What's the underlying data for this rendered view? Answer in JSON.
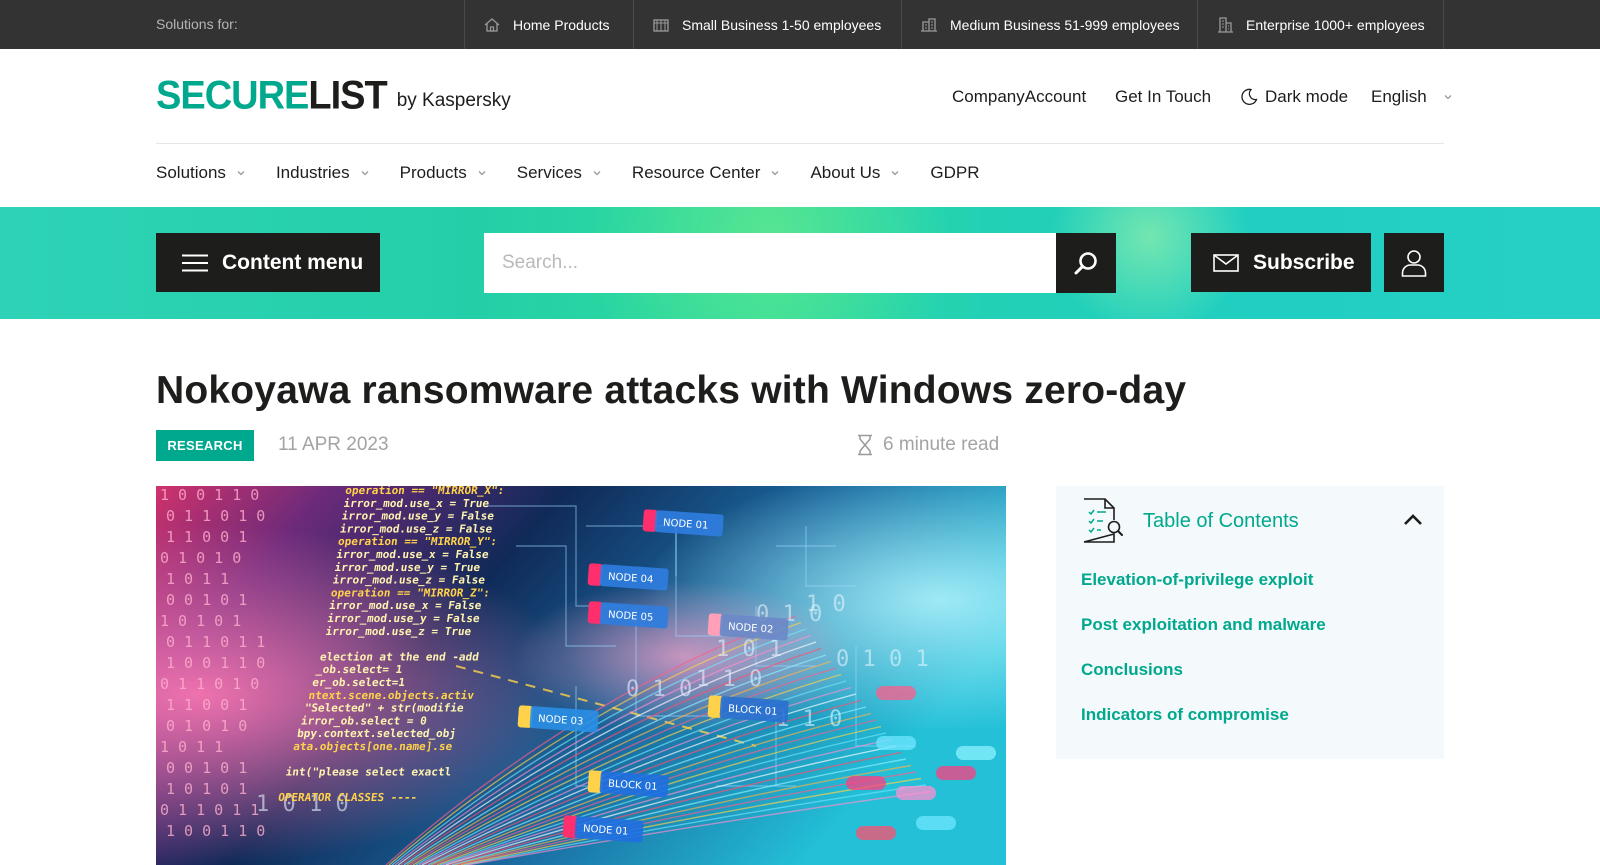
{
  "topbar": {
    "solutions_label": "Solutions for:",
    "segments": [
      {
        "label": "Home Products",
        "icon": "house-icon"
      },
      {
        "label": "Small Business 1-50 employees",
        "icon": "shop-icon"
      },
      {
        "label": "Medium Business 51-999 employees",
        "icon": "office-icon"
      },
      {
        "label": "Enterprise 1000+ employees",
        "icon": "tower-icon"
      }
    ]
  },
  "header": {
    "logo_secure": "SECURE",
    "logo_list": "LIST",
    "logo_by": "by Kaspersky",
    "links": {
      "company_account": "CompanyAccount",
      "get_in_touch": "Get In Touch",
      "dark_mode": "Dark mode",
      "language": "English"
    }
  },
  "nav": {
    "items": [
      "Solutions",
      "Industries",
      "Products",
      "Services",
      "Resource Center",
      "About Us",
      "GDPR"
    ]
  },
  "toolbar": {
    "content_menu": "Content menu",
    "search_placeholder": "Search...",
    "subscribe": "Subscribe"
  },
  "article": {
    "title": "Nokoyawa ransomware attacks with Windows zero-day",
    "category": "RESEARCH",
    "date": "11 APR 2023",
    "read_time": "6 minute read"
  },
  "hero": {
    "code_lines": [
      "operation == \"MIRROR_X\":",
      "irror_mod.use_x = True",
      "irror_mod.use_y = False",
      "irror_mod.use_z = False",
      "operation == \"MIRROR_Y\":",
      "irror_mod.use_x = False",
      "irror_mod.use_y = True",
      "irror_mod.use_z = False",
      "operation == \"MIRROR_Z\":",
      "irror_mod.use_x = False",
      "irror_mod.use_y = False",
      "irror_mod.use_z = True",
      "",
      "election at the end -add",
      "_ob.select= 1",
      "er_ob.select=1",
      "ntext.scene.objects.activ",
      "\"Selected\" + str(modifie",
      "irror_ob.select = 0",
      "bpy.context.selected_obj",
      "ata.objects[one.name].se",
      "",
      "int(\"please select exactl",
      "",
      "OPERATOR CLASSES ----"
    ],
    "nodes": [
      "NODE 01",
      "NODE 04",
      "NODE 05",
      "NODE 02",
      "NODE 03",
      "BLOCK 01",
      "BLOCK 01",
      "NODE 01"
    ],
    "digits": [
      "1 0 0 1 1 0",
      "0 1 1 0 1 0",
      "1 1 0 0 1",
      "0 1 0 1 0",
      "1 0 1 1",
      "0 0 1 0 1",
      "1 0 1 0 1",
      "0 1 1 0 1 1"
    ]
  },
  "toc": {
    "title": "Table of Contents",
    "items": [
      "Elevation-of-privilege exploit",
      "Post exploitation and malware",
      "Conclusions",
      "Indicators of compromise"
    ]
  }
}
